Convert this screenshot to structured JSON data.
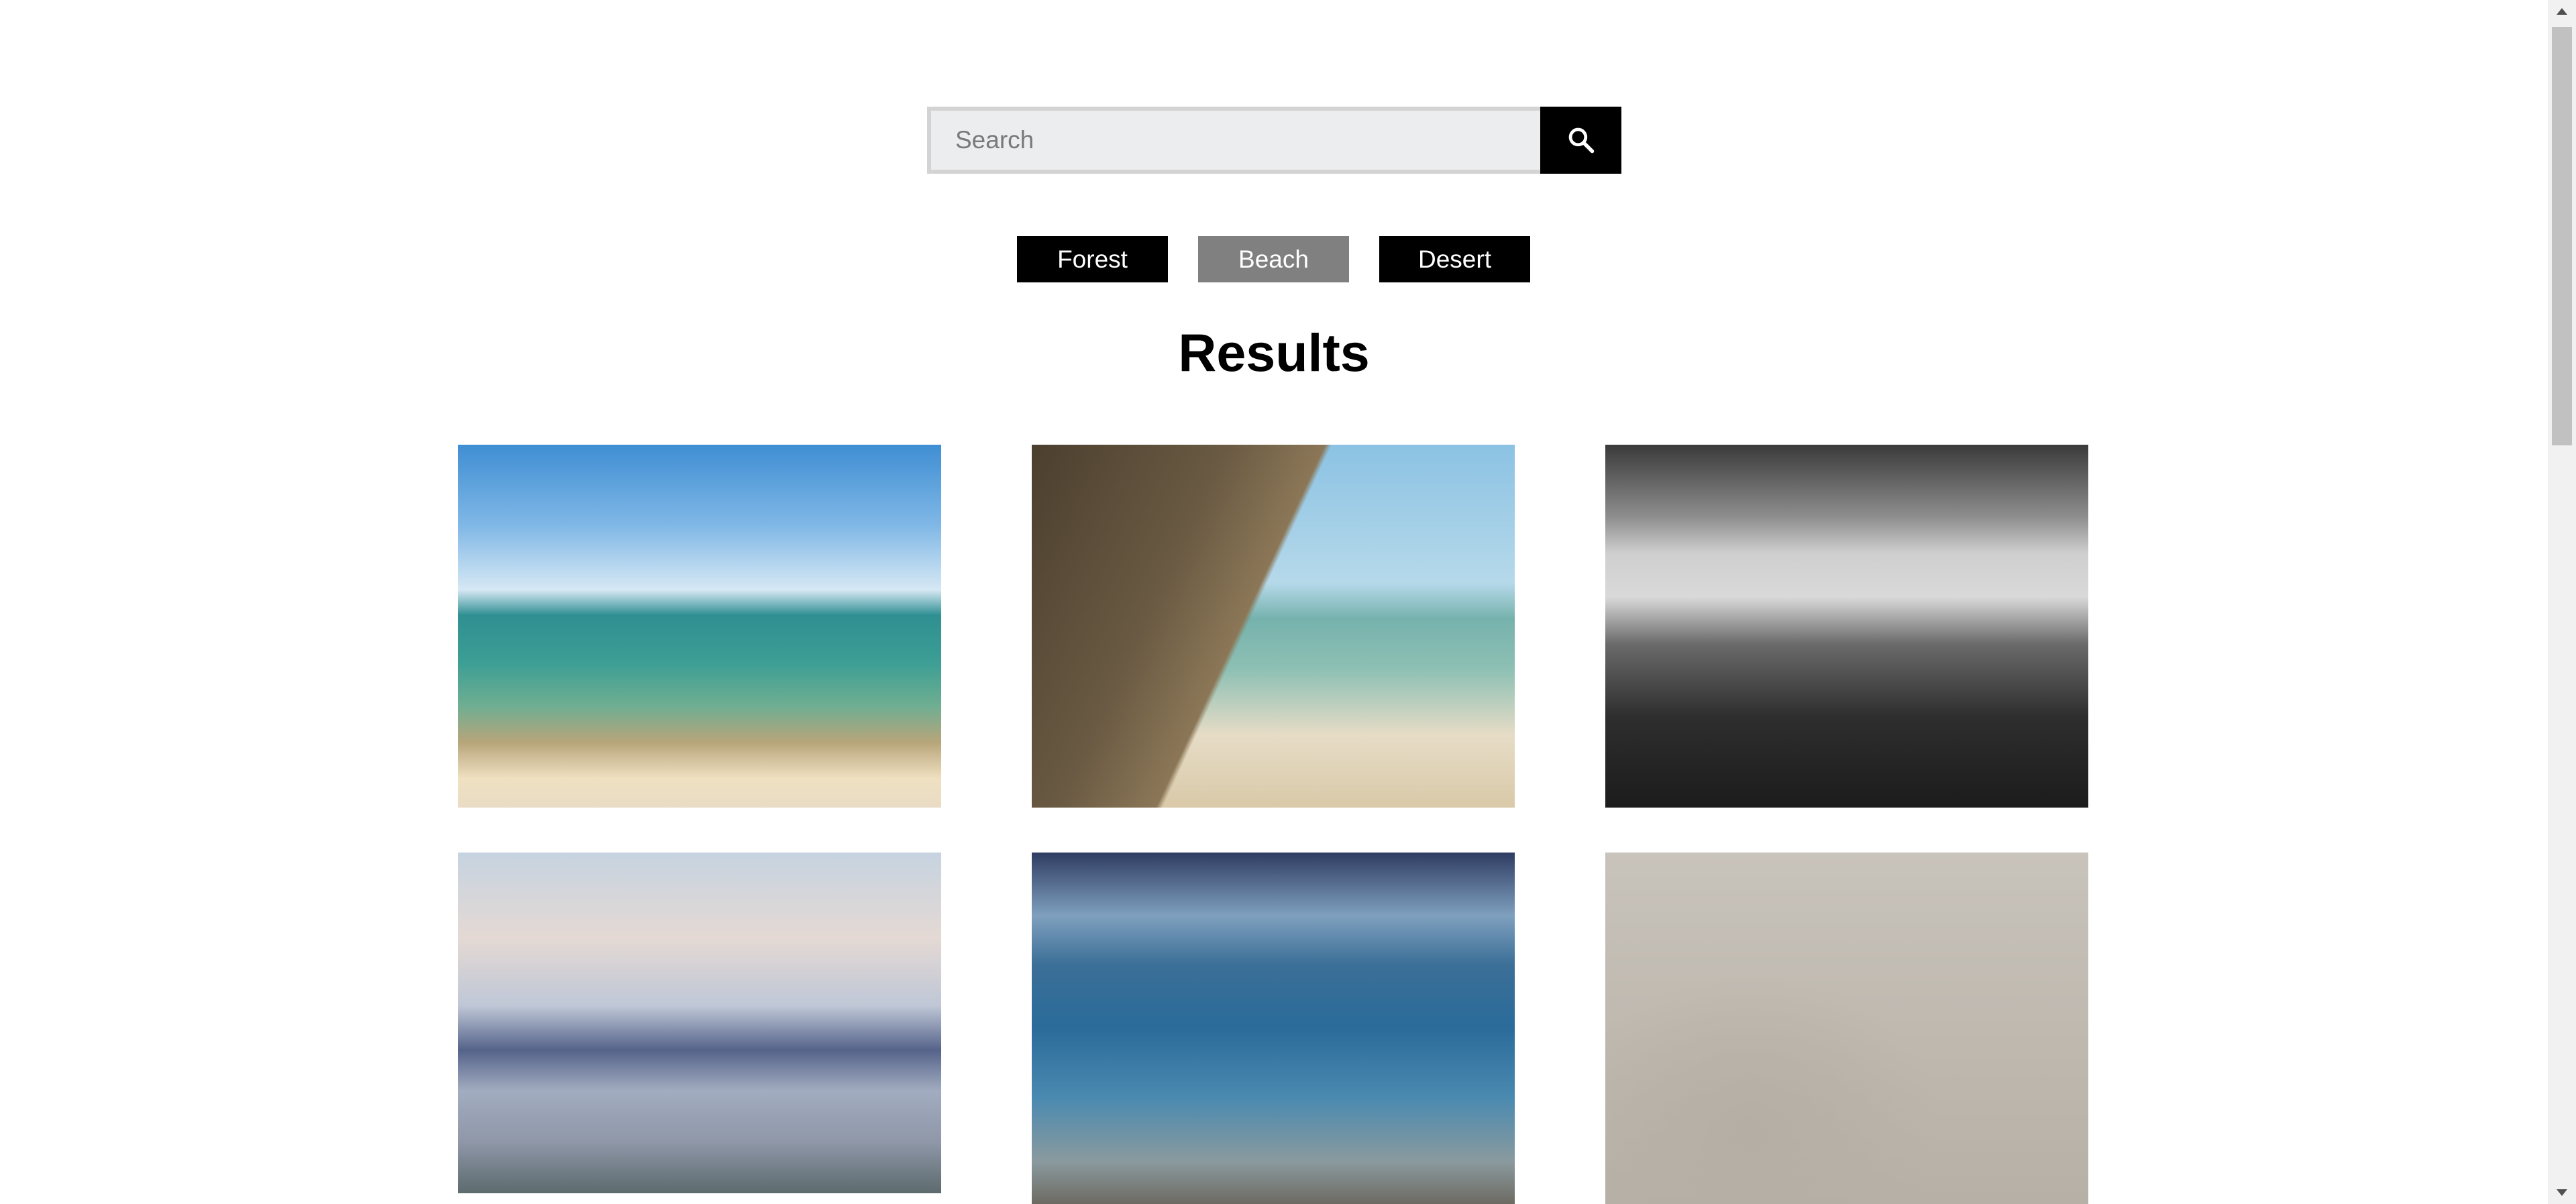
{
  "search": {
    "placeholder": "Search",
    "value": "",
    "button_icon": "search-icon"
  },
  "filters": [
    {
      "label": "Forest",
      "active": false
    },
    {
      "label": "Beach",
      "active": true
    },
    {
      "label": "Desert",
      "active": false
    }
  ],
  "results": {
    "title": "Results",
    "items": [
      {
        "subject": "beach with turquoise sea and blue sky"
      },
      {
        "subject": "person on bluff above beach with bare branches"
      },
      {
        "subject": "black and white rocky shore with waves"
      },
      {
        "subject": "cloudy sky over rocky coastline"
      },
      {
        "subject": "blue water with rocks along shore"
      },
      {
        "subject": "footprints in sand"
      }
    ]
  },
  "colors": {
    "button_dark": "#000000",
    "button_active": "#808080",
    "search_bg": "#ebedef"
  }
}
